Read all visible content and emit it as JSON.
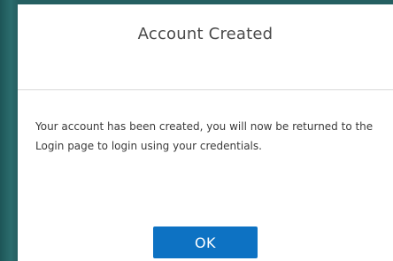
{
  "dialog": {
    "title": "Account Created",
    "message": "Your account has been created, you will now be returned to the Login page to login using your credentials.",
    "ok_label": "OK"
  },
  "colors": {
    "backdrop": "#1f5a5c",
    "button": "#0d72c3"
  }
}
